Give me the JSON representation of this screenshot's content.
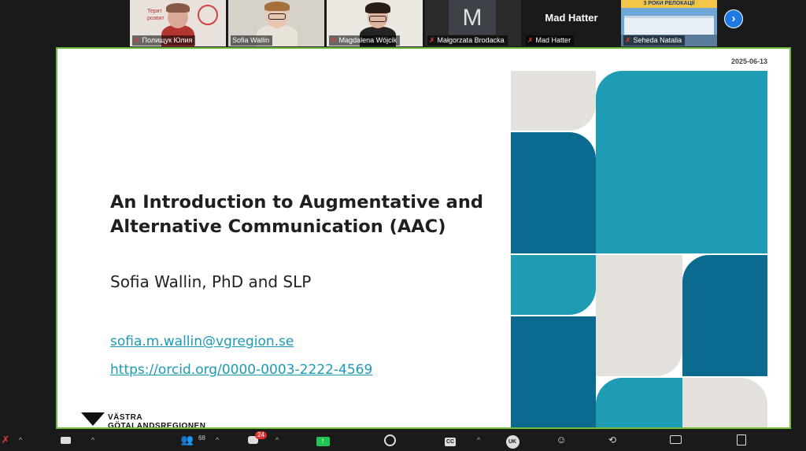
{
  "participants": [
    {
      "name": "Полищук Юлия",
      "muted": true,
      "bg_text": "Терит розвит"
    },
    {
      "name": "Sofia Wallin",
      "muted": false
    },
    {
      "name": "Magdalena Wójcik",
      "muted": true
    },
    {
      "name": "Małgorzata Brodacka",
      "muted": true,
      "initial": "M"
    },
    {
      "name": "Mad Hatter",
      "muted": true,
      "display_name": "Mad Hatter"
    },
    {
      "name": "Seheda Natalia",
      "muted": true,
      "banner": "3 РОКИ РЕЛОКАЦІЇ"
    }
  ],
  "next_arrow": "›",
  "slide": {
    "date": "2025-06-13",
    "title": "An Introduction to Augmentative and Alternative Communication (AAC)",
    "author": "Sofia Wallin, PhD and SLP",
    "email": "sofia.m.wallin@vgregion.se",
    "orcid": "https://orcid.org/0000-0003-2222-4569",
    "logo_line1": "VÄSTRA",
    "logo_line2": "GÖTALANDSREGIONEN",
    "colors": {
      "teal": "#1e9cb3",
      "navy": "#0a6a8f",
      "gray": "#e4e0dc"
    }
  },
  "toolbar": {
    "participants_count": "68",
    "chat_badge": "24",
    "cc_label": "CC",
    "language_label": "UK"
  }
}
